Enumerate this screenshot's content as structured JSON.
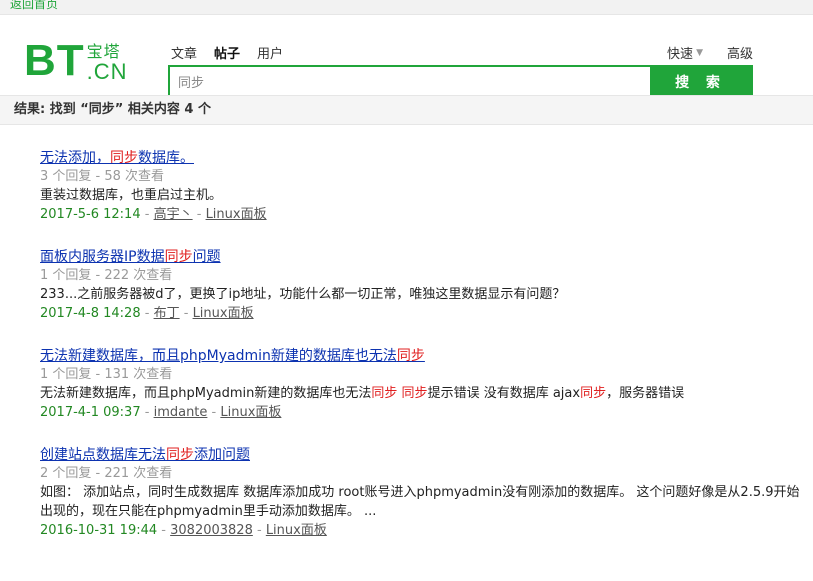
{
  "topbar": {
    "back_link": "返回首页"
  },
  "logo": {
    "bt": "BT",
    "cn_top": "宝塔",
    "cn_bottom": ".CN"
  },
  "tabs": [
    {
      "label": "文章",
      "active": false
    },
    {
      "label": "帖子",
      "active": true
    },
    {
      "label": "用户",
      "active": false
    }
  ],
  "right_links": {
    "quick": "快速",
    "advanced": "高级"
  },
  "search": {
    "value": "同步",
    "button": "搜 索"
  },
  "summary": "结果: 找到 “同步” 相关内容 4 个",
  "results": [
    {
      "title": [
        "无法添加，",
        "同步",
        "数据库。"
      ],
      "meta": "3 个回复 - 58 次查看",
      "desc": [
        "重装过数据库，也重启过主机。"
      ],
      "date": "2017-5-6 12:14",
      "author": "高宇丶",
      "board": "Linux面板"
    },
    {
      "title": [
        "面板内服务器IP数据",
        "同步",
        "问题"
      ],
      "meta": "1 个回复 - 222 次查看",
      "desc": [
        "233...之前服务器被d了，更换了ip地址，功能什么都一切正常，唯独这里数据显示有问题？"
      ],
      "date": "2017-4-8 14:28",
      "author": "布丁",
      "board": "Linux面板"
    },
    {
      "title": [
        "无法新建数据库，而且phpMyadmin新建的数据库也无法",
        "同步",
        ""
      ],
      "meta": "1 个回复 - 131 次查看",
      "desc": [
        "无法新建数据库，而且phpMyadmin新建的数据库也无法",
        "同步",
        " ",
        "同步",
        "提示错误 没有数据库 ajax",
        "同步",
        "，服务器错误"
      ],
      "date": "2017-4-1 09:37",
      "author": "imdante",
      "board": "Linux面板"
    },
    {
      "title": [
        "创建站点数据库无法",
        "同步",
        "添加问题"
      ],
      "meta": "2 个回复 - 221 次查看",
      "desc": [
        "如图： 添加站点，同时生成数据库 数据库添加成功 root账号进入phpmyadmin没有刚添加的数据库。 这个问题好像是从2.5.9开始出现的，现在只能在phpmyadmin里手动添加数据库。 ..."
      ],
      "date": "2016-10-31 19:44",
      "author": "3082003828",
      "board": "Linux面板"
    }
  ],
  "colors": {
    "brand": "#20a53a",
    "link": "#0d33b0",
    "highlight": "#e02020"
  }
}
